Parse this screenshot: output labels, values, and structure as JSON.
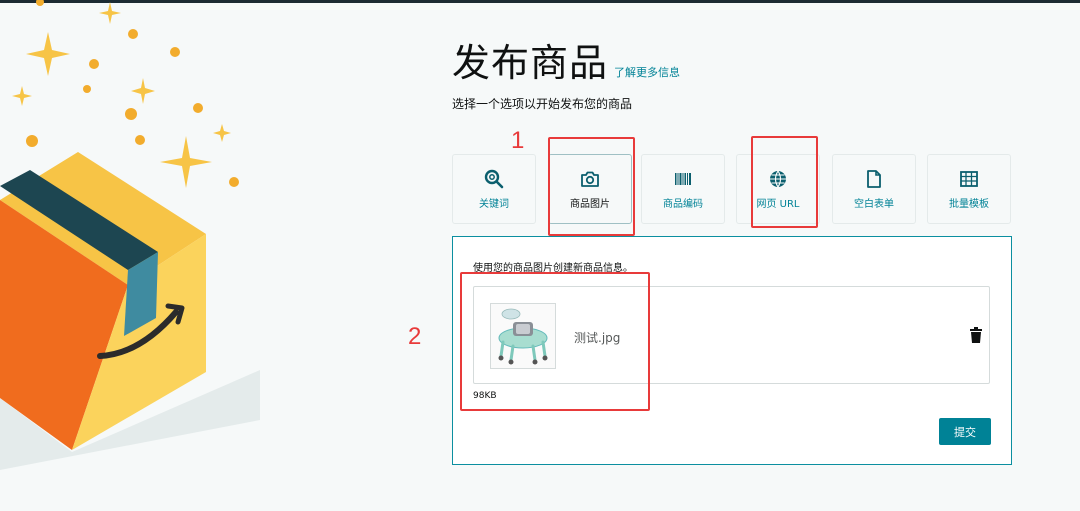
{
  "header": {
    "title": "发布商品",
    "learn_more": "了解更多信息",
    "subtitle": "选择一个选项以开始发布您的商品"
  },
  "tabs": [
    {
      "label": "关键词",
      "icon": "search-icon"
    },
    {
      "label": "商品图片",
      "icon": "camera-icon",
      "selected": true
    },
    {
      "label": "商品编码",
      "icon": "barcode-icon"
    },
    {
      "label": "网页 URL",
      "icon": "globe-icon"
    },
    {
      "label": "空白表单",
      "icon": "document-icon"
    },
    {
      "label": "批量模板",
      "icon": "spreadsheet-icon"
    }
  ],
  "panel": {
    "description": "使用您的商品图片创建新商品信息。",
    "file": {
      "name": "测试.jpg",
      "size": "98KB"
    },
    "submit_label": "提交"
  },
  "annotations": {
    "marker_1": "1",
    "marker_2": "2"
  },
  "colors": {
    "accent": "#008296",
    "marker": "#e83a3a",
    "box_orange": "#f7c446",
    "box_dark": "#1d4651"
  }
}
